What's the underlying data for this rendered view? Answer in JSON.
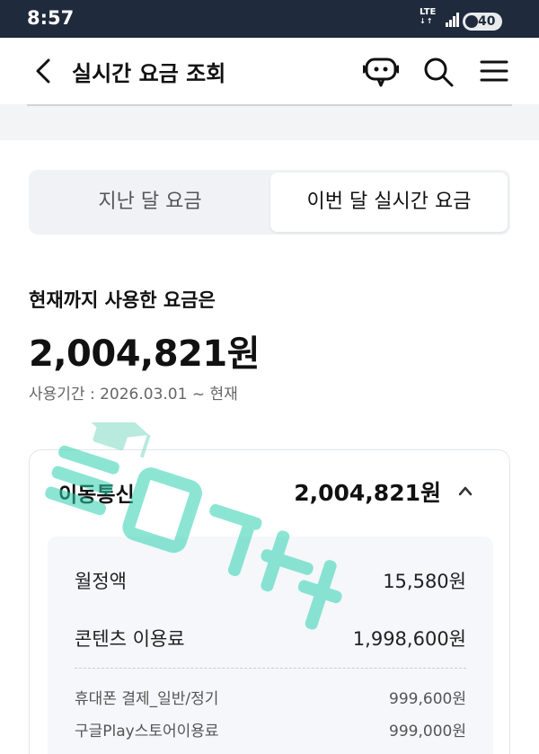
{
  "status_bar": {
    "time": "8:57",
    "network": "LTE",
    "battery": "40"
  },
  "header": {
    "title": "실시간 요금 조회",
    "icons": [
      "back-icon",
      "chatbot-icon",
      "search-icon",
      "menu-icon"
    ]
  },
  "tabs": [
    {
      "label": "지난 달 요금",
      "selected": false
    },
    {
      "label": "이번 달 실시간 요금",
      "selected": true
    }
  ],
  "summary": {
    "label": "현재까지 사용한 요금은",
    "total": "2,004,821원",
    "period": "사용기간 : 2026.03.01 ~ 현재"
  },
  "mobile_card": {
    "title": "이동통신",
    "amount": "2,004,821원",
    "items": [
      {
        "label": "월정액",
        "value": "15,580원"
      },
      {
        "label": "콘텐츠 이용료",
        "value": "1,998,600원"
      }
    ],
    "sub_items": [
      {
        "label": "휴대폰 결제_일반/정기",
        "value": "999,600원"
      },
      {
        "label": "구글Play스토어이용료",
        "value": "999,000원"
      }
    ]
  },
  "colors": {
    "status_bar": "#1f2a3c",
    "watermark": "#2fd1b0"
  }
}
